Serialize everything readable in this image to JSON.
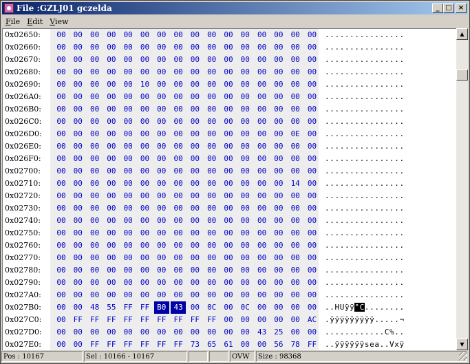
{
  "window": {
    "title": "File :GZLJ01 gczelda",
    "buttons": {
      "minimize": "_",
      "maximize": "□",
      "close": "×"
    }
  },
  "menu": {
    "items": [
      "File",
      "Edit",
      "View"
    ]
  },
  "hex_rows": [
    {
      "offset": "0x02650:",
      "bytes": [
        "00",
        "00",
        "00",
        "00",
        "00",
        "00",
        "00",
        "00",
        "00",
        "00",
        "00",
        "00",
        "00",
        "00",
        "00",
        "00"
      ],
      "ascii": "................",
      "sel_bytes": [],
      "sel_ascii": []
    },
    {
      "offset": "0x02660:",
      "bytes": [
        "00",
        "00",
        "00",
        "00",
        "00",
        "00",
        "00",
        "00",
        "00",
        "00",
        "00",
        "00",
        "00",
        "00",
        "00",
        "00"
      ],
      "ascii": "................",
      "sel_bytes": [],
      "sel_ascii": []
    },
    {
      "offset": "0x02670:",
      "bytes": [
        "00",
        "00",
        "00",
        "00",
        "00",
        "00",
        "00",
        "00",
        "00",
        "00",
        "00",
        "00",
        "00",
        "00",
        "00",
        "00"
      ],
      "ascii": "................",
      "sel_bytes": [],
      "sel_ascii": []
    },
    {
      "offset": "0x02680:",
      "bytes": [
        "00",
        "00",
        "00",
        "00",
        "00",
        "00",
        "00",
        "00",
        "00",
        "00",
        "00",
        "00",
        "00",
        "00",
        "00",
        "00"
      ],
      "ascii": "................",
      "sel_bytes": [],
      "sel_ascii": []
    },
    {
      "offset": "0x02690:",
      "bytes": [
        "00",
        "00",
        "00",
        "00",
        "00",
        "10",
        "00",
        "00",
        "00",
        "00",
        "00",
        "00",
        "00",
        "00",
        "00",
        "00"
      ],
      "ascii": "................",
      "sel_bytes": [],
      "sel_ascii": []
    },
    {
      "offset": "0x026A0:",
      "bytes": [
        "00",
        "00",
        "00",
        "00",
        "00",
        "00",
        "00",
        "00",
        "00",
        "00",
        "00",
        "00",
        "00",
        "00",
        "00",
        "00"
      ],
      "ascii": "................",
      "sel_bytes": [],
      "sel_ascii": []
    },
    {
      "offset": "0x026B0:",
      "bytes": [
        "00",
        "00",
        "00",
        "00",
        "00",
        "00",
        "00",
        "00",
        "00",
        "00",
        "00",
        "00",
        "00",
        "00",
        "00",
        "00"
      ],
      "ascii": "................",
      "sel_bytes": [],
      "sel_ascii": []
    },
    {
      "offset": "0x026C0:",
      "bytes": [
        "00",
        "00",
        "00",
        "00",
        "00",
        "00",
        "00",
        "00",
        "00",
        "00",
        "00",
        "00",
        "00",
        "00",
        "00",
        "00"
      ],
      "ascii": "................",
      "sel_bytes": [],
      "sel_ascii": []
    },
    {
      "offset": "0x026D0:",
      "bytes": [
        "00",
        "00",
        "00",
        "00",
        "00",
        "00",
        "00",
        "00",
        "00",
        "00",
        "00",
        "00",
        "00",
        "00",
        "0E",
        "00"
      ],
      "ascii": "................",
      "sel_bytes": [],
      "sel_ascii": []
    },
    {
      "offset": "0x026E0:",
      "bytes": [
        "00",
        "00",
        "00",
        "00",
        "00",
        "00",
        "00",
        "00",
        "00",
        "00",
        "00",
        "00",
        "00",
        "00",
        "00",
        "00"
      ],
      "ascii": "................",
      "sel_bytes": [],
      "sel_ascii": []
    },
    {
      "offset": "0x026F0:",
      "bytes": [
        "00",
        "00",
        "00",
        "00",
        "00",
        "00",
        "00",
        "00",
        "00",
        "00",
        "00",
        "00",
        "00",
        "00",
        "00",
        "00"
      ],
      "ascii": "................",
      "sel_bytes": [],
      "sel_ascii": []
    },
    {
      "offset": "0x02700:",
      "bytes": [
        "00",
        "00",
        "00",
        "00",
        "00",
        "00",
        "00",
        "00",
        "00",
        "00",
        "00",
        "00",
        "00",
        "00",
        "00",
        "00"
      ],
      "ascii": "................",
      "sel_bytes": [],
      "sel_ascii": []
    },
    {
      "offset": "0x02710:",
      "bytes": [
        "00",
        "00",
        "00",
        "00",
        "00",
        "00",
        "00",
        "00",
        "00",
        "00",
        "00",
        "00",
        "00",
        "00",
        "14",
        "00"
      ],
      "ascii": "................",
      "sel_bytes": [],
      "sel_ascii": []
    },
    {
      "offset": "0x02720:",
      "bytes": [
        "00",
        "00",
        "00",
        "00",
        "00",
        "00",
        "00",
        "00",
        "00",
        "00",
        "00",
        "00",
        "00",
        "00",
        "00",
        "00"
      ],
      "ascii": "................",
      "sel_bytes": [],
      "sel_ascii": []
    },
    {
      "offset": "0x02730:",
      "bytes": [
        "00",
        "00",
        "00",
        "00",
        "00",
        "00",
        "00",
        "00",
        "00",
        "00",
        "00",
        "00",
        "00",
        "00",
        "00",
        "00"
      ],
      "ascii": "................",
      "sel_bytes": [],
      "sel_ascii": []
    },
    {
      "offset": "0x02740:",
      "bytes": [
        "00",
        "00",
        "00",
        "00",
        "00",
        "00",
        "00",
        "00",
        "00",
        "00",
        "00",
        "00",
        "00",
        "00",
        "00",
        "00"
      ],
      "ascii": "................",
      "sel_bytes": [],
      "sel_ascii": []
    },
    {
      "offset": "0x02750:",
      "bytes": [
        "00",
        "00",
        "00",
        "00",
        "00",
        "00",
        "00",
        "00",
        "00",
        "00",
        "00",
        "00",
        "00",
        "00",
        "00",
        "00"
      ],
      "ascii": "................",
      "sel_bytes": [],
      "sel_ascii": []
    },
    {
      "offset": "0x02760:",
      "bytes": [
        "00",
        "00",
        "00",
        "00",
        "00",
        "00",
        "00",
        "00",
        "00",
        "00",
        "00",
        "00",
        "00",
        "00",
        "00",
        "00"
      ],
      "ascii": "................",
      "sel_bytes": [],
      "sel_ascii": []
    },
    {
      "offset": "0x02770:",
      "bytes": [
        "00",
        "00",
        "00",
        "00",
        "00",
        "00",
        "00",
        "00",
        "00",
        "00",
        "00",
        "00",
        "00",
        "00",
        "00",
        "00"
      ],
      "ascii": "................",
      "sel_bytes": [],
      "sel_ascii": []
    },
    {
      "offset": "0x02780:",
      "bytes": [
        "00",
        "00",
        "00",
        "00",
        "00",
        "00",
        "00",
        "00",
        "00",
        "00",
        "00",
        "00",
        "00",
        "00",
        "00",
        "00"
      ],
      "ascii": "................",
      "sel_bytes": [],
      "sel_ascii": []
    },
    {
      "offset": "0x02790:",
      "bytes": [
        "00",
        "00",
        "00",
        "00",
        "00",
        "00",
        "00",
        "00",
        "00",
        "00",
        "00",
        "00",
        "00",
        "00",
        "00",
        "00"
      ],
      "ascii": "................",
      "sel_bytes": [],
      "sel_ascii": []
    },
    {
      "offset": "0x027A0:",
      "bytes": [
        "00",
        "00",
        "00",
        "00",
        "00",
        "00",
        "00",
        "00",
        "00",
        "00",
        "00",
        "00",
        "00",
        "00",
        "00",
        "00"
      ],
      "ascii": "................",
      "sel_bytes": [],
      "sel_ascii": []
    },
    {
      "offset": "0x027B0:",
      "bytes": [
        "00",
        "00",
        "48",
        "55",
        "FF",
        "FF",
        "B0",
        "43",
        "00",
        "0C",
        "00",
        "0C",
        "00",
        "00",
        "00",
        "00"
      ],
      "ascii": "..HUÿÿ°C........",
      "sel_bytes": [
        6,
        7
      ],
      "sel_ascii": [
        6,
        7
      ]
    },
    {
      "offset": "0x027C0:",
      "bytes": [
        "00",
        "FF",
        "FF",
        "FF",
        "FF",
        "FF",
        "FF",
        "FF",
        "FF",
        "FF",
        "00",
        "00",
        "00",
        "00",
        "00",
        "AC"
      ],
      "ascii": ".ÿÿÿÿÿÿÿÿÿ.....¬",
      "sel_bytes": [],
      "sel_ascii": []
    },
    {
      "offset": "0x027D0:",
      "bytes": [
        "00",
        "00",
        "00",
        "00",
        "00",
        "00",
        "00",
        "00",
        "00",
        "00",
        "00",
        "00",
        "43",
        "25",
        "00",
        "00"
      ],
      "ascii": "............C%..",
      "sel_bytes": [],
      "sel_ascii": []
    },
    {
      "offset": "0x027E0:",
      "bytes": [
        "00",
        "00",
        "FF",
        "FF",
        "FF",
        "FF",
        "FF",
        "FF",
        "73",
        "65",
        "61",
        "00",
        "00",
        "56",
        "78",
        "FF"
      ],
      "ascii": "..ÿÿÿÿÿÿsea..Vxÿ",
      "sel_bytes": [],
      "sel_ascii": []
    }
  ],
  "scrollbar": {
    "up": "▲",
    "down": "▼"
  },
  "status": {
    "pos": "Pos : 10167",
    "sel": "Sel : 10166 - 10167",
    "blank1": "",
    "blank2": "",
    "mode": "OVW",
    "size": "Size : 98368"
  },
  "colors": {
    "hex_byte": "#0000c8",
    "selection_hex_bg": "#0000a8",
    "selection_ascii_bg": "#000000",
    "title_gradient_start": "#0a246a",
    "title_gradient_end": "#a6caf0"
  }
}
